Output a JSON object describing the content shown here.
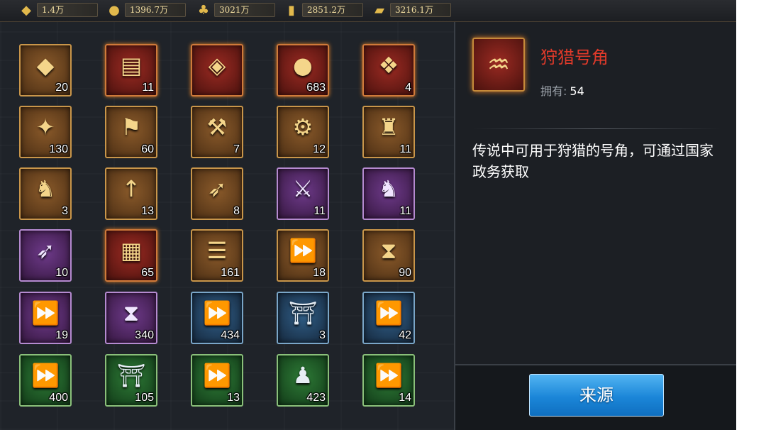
{
  "resources": [
    {
      "icon": "gold-ingot-icon",
      "glyph": "◆",
      "value": "1.4万"
    },
    {
      "icon": "silver-coin-icon",
      "glyph": "●",
      "value": "1396.7万"
    },
    {
      "icon": "grain-sack-icon",
      "glyph": "♣",
      "value": "3021万"
    },
    {
      "icon": "wood-log-icon",
      "glyph": "▮",
      "value": "2851.2万"
    },
    {
      "icon": "iron-ingot-icon",
      "glyph": "▰",
      "value": "3216.1万"
    }
  ],
  "items": [
    {
      "name": "ore-icon",
      "glyph": "◆",
      "rarity": "orange",
      "count": "20"
    },
    {
      "name": "rename-card-icon",
      "glyph": "▤",
      "rarity": "red",
      "count": "11"
    },
    {
      "name": "name-change-card-icon",
      "glyph": "◈",
      "rarity": "red",
      "count": ""
    },
    {
      "name": "gold-orb-icon",
      "glyph": "●",
      "rarity": "red",
      "count": "683"
    },
    {
      "name": "jade-pouch-icon",
      "glyph": "❖",
      "rarity": "red",
      "count": "4"
    },
    {
      "name": "crystal-icon",
      "glyph": "✦",
      "rarity": "orange",
      "count": "130"
    },
    {
      "name": "flag-icon",
      "glyph": "⚑",
      "rarity": "orange",
      "count": "60"
    },
    {
      "name": "catapult-pouch-icon",
      "glyph": "⚒",
      "rarity": "orange",
      "count": "7"
    },
    {
      "name": "cannon-pouch-icon",
      "glyph": "⚙",
      "rarity": "orange",
      "count": "12"
    },
    {
      "name": "fortress-pouch-icon",
      "glyph": "♜",
      "rarity": "orange",
      "count": "11"
    },
    {
      "name": "cavalry-scroll-icon",
      "glyph": "♞",
      "rarity": "orange",
      "count": "3"
    },
    {
      "name": "spear-scroll-icon",
      "glyph": "↑",
      "rarity": "orange",
      "count": "13"
    },
    {
      "name": "bow-scroll-icon",
      "glyph": "➶",
      "rarity": "orange",
      "count": "8"
    },
    {
      "name": "sword-scroll-icon",
      "glyph": "⚔",
      "rarity": "purple",
      "count": "11"
    },
    {
      "name": "horse-scroll-icon",
      "glyph": "♞",
      "rarity": "purple",
      "count": "11"
    },
    {
      "name": "archer-scroll-icon",
      "glyph": "➶",
      "rarity": "purple",
      "count": "10"
    },
    {
      "name": "jade-book-icon",
      "glyph": "▦",
      "rarity": "red",
      "count": "65"
    },
    {
      "name": "scroll-bundle-icon",
      "glyph": "☰",
      "rarity": "orange",
      "count": "161"
    },
    {
      "name": "speedup-icon",
      "glyph": "⏩",
      "rarity": "orange",
      "count": "18"
    },
    {
      "name": "hourglass-icon",
      "glyph": "⧗",
      "rarity": "orange",
      "count": "90"
    },
    {
      "name": "equip-speedup-icon",
      "glyph": "⏩",
      "rarity": "purple",
      "count": "19"
    },
    {
      "name": "hourglass-icon",
      "glyph": "⧗",
      "rarity": "purple",
      "count": "340"
    },
    {
      "name": "speedup-icon",
      "glyph": "⏩",
      "rarity": "blue",
      "count": "434"
    },
    {
      "name": "building-speedup-icon",
      "glyph": "⛩",
      "rarity": "blue",
      "count": "3"
    },
    {
      "name": "equip-speedup-icon",
      "glyph": "⏩",
      "rarity": "blue",
      "count": "42"
    },
    {
      "name": "speedup-icon",
      "glyph": "⏩",
      "rarity": "green",
      "count": "400"
    },
    {
      "name": "building-speedup-icon",
      "glyph": "⛩",
      "rarity": "green",
      "count": "105"
    },
    {
      "name": "equip-speedup-icon",
      "glyph": "⏩",
      "rarity": "green",
      "count": "13"
    },
    {
      "name": "troop-speedup-icon",
      "glyph": "♟",
      "rarity": "green",
      "count": "423"
    },
    {
      "name": "speedup-icon",
      "glyph": "⏩",
      "rarity": "green",
      "count": "14"
    }
  ],
  "detail": {
    "icon": "horn-icon",
    "glyph": "♒",
    "name": "狩猎号角",
    "owned_label": "拥有:",
    "owned_value": "54",
    "description": "传说中可用于狩猎的号角，可通过国家政务获取"
  },
  "source_button": "来源",
  "colors": {
    "item_name": "#e03a2a",
    "button": "#1b86d8"
  }
}
